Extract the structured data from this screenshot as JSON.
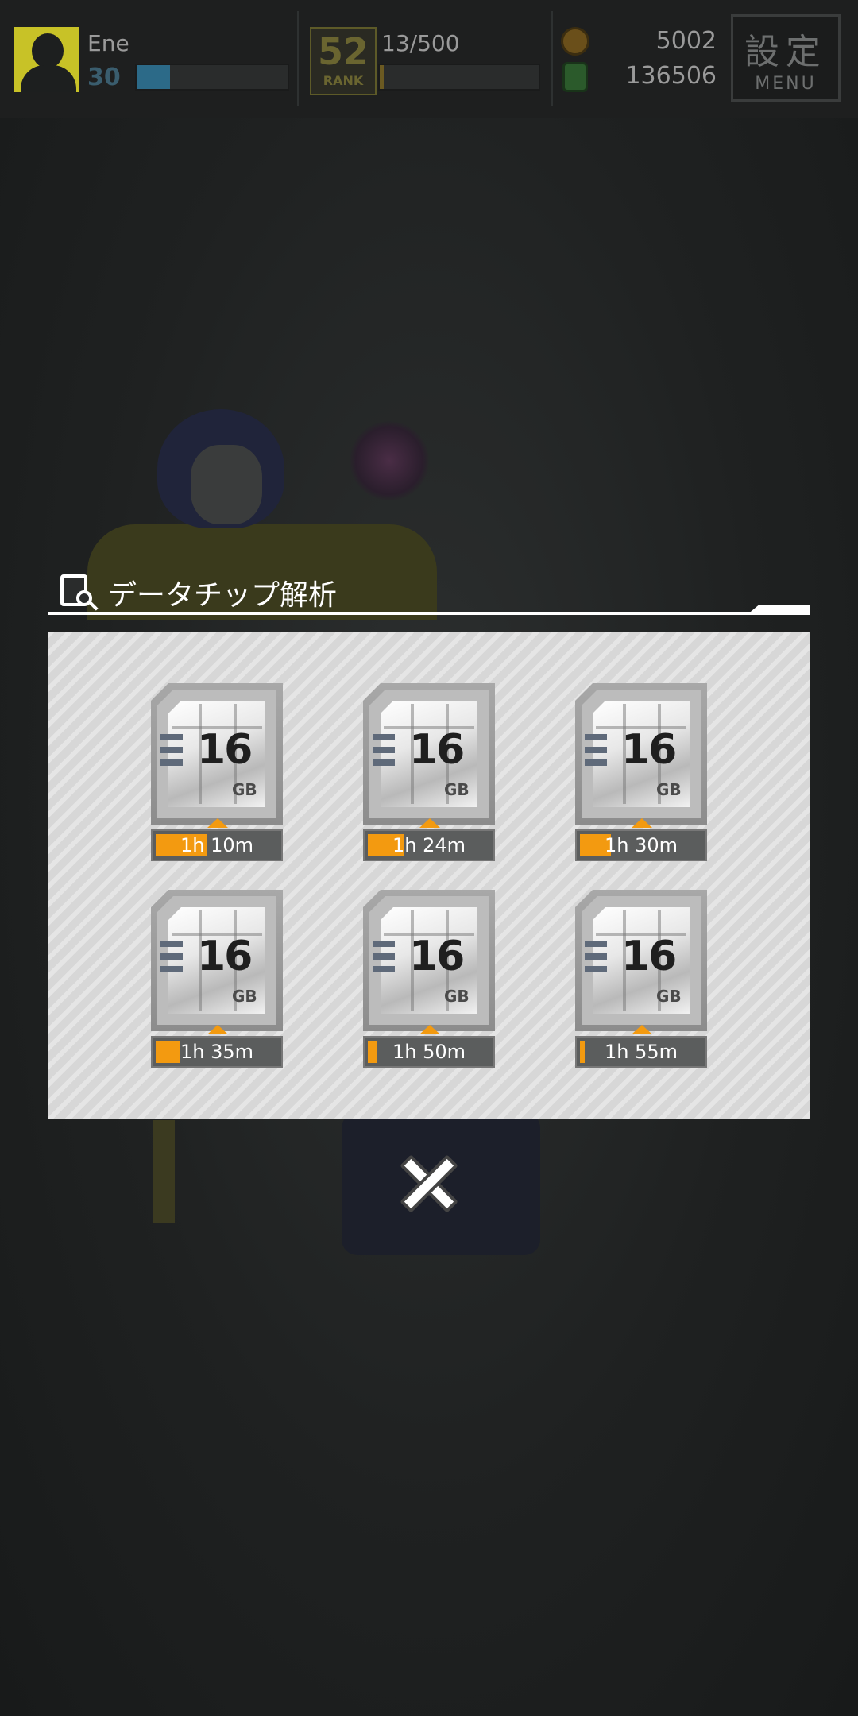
{
  "hud": {
    "player_name": "Ene",
    "player_level": "30",
    "exp_progress": 0.22,
    "rank_number": "52",
    "rank_label": "RANK",
    "stamina": "13/500",
    "stamina_progress": 0.026,
    "coins": "5002",
    "gems": "136506",
    "menu_kanji": "設定",
    "menu_label": "MENU"
  },
  "dialog": {
    "title": "データチップ解析",
    "chips": [
      {
        "capacity": "16",
        "unit": "GB",
        "time": "1h 10m",
        "progress": 0.42
      },
      {
        "capacity": "16",
        "unit": "GB",
        "time": "1h 24m",
        "progress": 0.3
      },
      {
        "capacity": "16",
        "unit": "GB",
        "time": "1h 30m",
        "progress": 0.25
      },
      {
        "capacity": "16",
        "unit": "GB",
        "time": "1h 35m",
        "progress": 0.2
      },
      {
        "capacity": "16",
        "unit": "GB",
        "time": "1h 50m",
        "progress": 0.08
      },
      {
        "capacity": "16",
        "unit": "GB",
        "time": "1h 55m",
        "progress": 0.04
      }
    ]
  },
  "colors": {
    "accent": "#f39a10",
    "panel": "#d7d7d7",
    "overlay": "#1f2121"
  }
}
